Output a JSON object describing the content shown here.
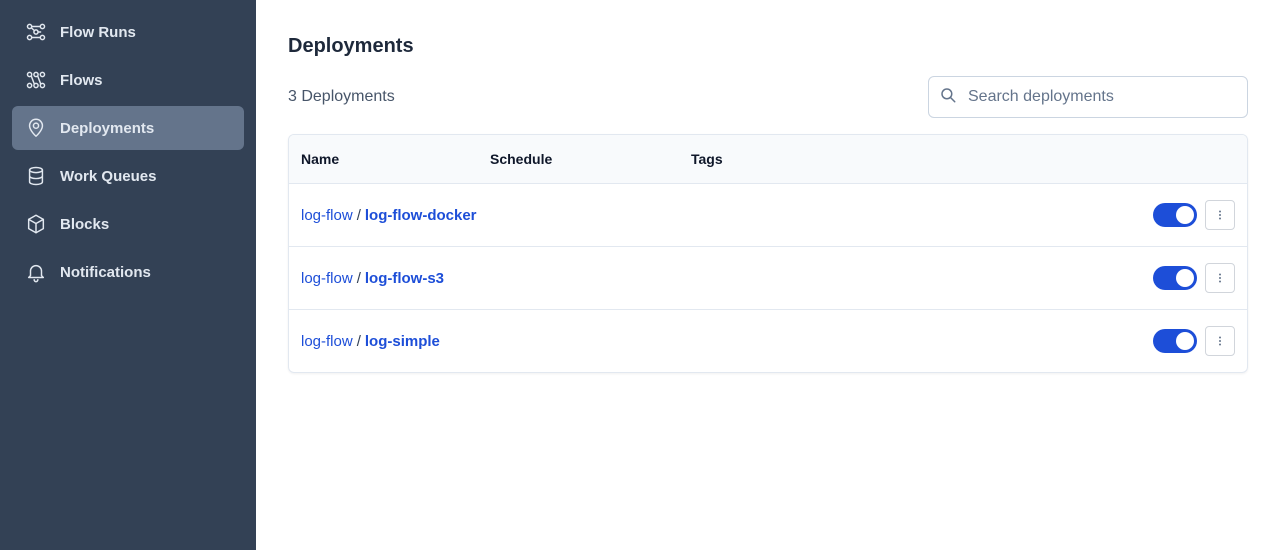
{
  "sidebar": {
    "items": [
      {
        "label": "Flow Runs",
        "icon": "flow-runs-icon",
        "active": false
      },
      {
        "label": "Flows",
        "icon": "flows-icon",
        "active": false
      },
      {
        "label": "Deployments",
        "icon": "map-pin-icon",
        "active": true
      },
      {
        "label": "Work Queues",
        "icon": "database-icon",
        "active": false
      },
      {
        "label": "Blocks",
        "icon": "cube-icon",
        "active": false
      },
      {
        "label": "Notifications",
        "icon": "bell-icon",
        "active": false
      }
    ]
  },
  "page": {
    "title": "Deployments",
    "count_label": "3 Deployments"
  },
  "search": {
    "placeholder": "Search deployments",
    "value": ""
  },
  "table": {
    "columns": [
      "Name",
      "Schedule",
      "Tags"
    ],
    "rows": [
      {
        "flow": "log-flow",
        "separator": "/",
        "deployment": "log-flow-docker",
        "enabled": true
      },
      {
        "flow": "log-flow",
        "separator": "/",
        "deployment": "log-flow-s3",
        "enabled": true
      },
      {
        "flow": "log-flow",
        "separator": "/",
        "deployment": "log-simple",
        "enabled": true
      }
    ]
  },
  "colors": {
    "sidebar_bg": "#334155",
    "sidebar_active": "#64748b",
    "link": "#1d4ed8",
    "toggle_on": "#1d4ed8"
  }
}
